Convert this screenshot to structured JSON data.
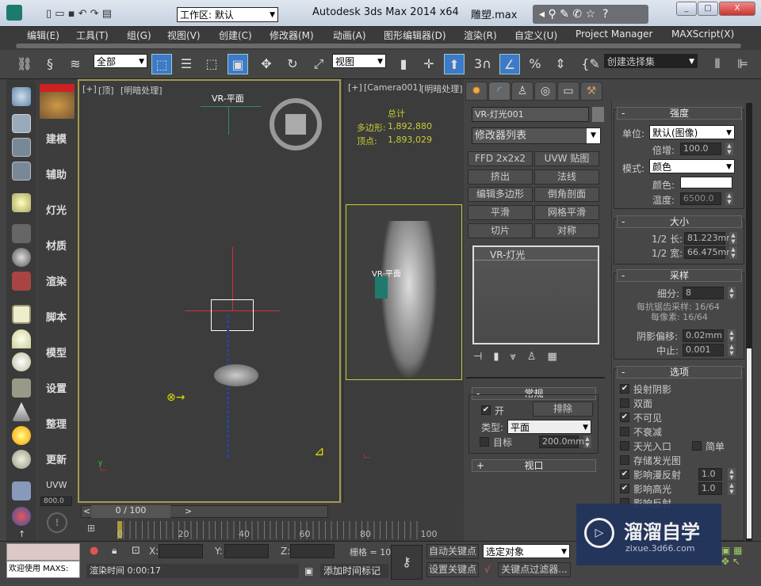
{
  "titlebar": {
    "workspace_label": "工作区: 默认",
    "app_title": "Autodesk 3ds Max  2014 x64",
    "file_name": "雕塑.max"
  },
  "menu": [
    "编辑(E)",
    "工具(T)",
    "组(G)",
    "视图(V)",
    "创建(C)",
    "修改器(M)",
    "动画(A)",
    "图形编辑器(D)",
    "渲染(R)",
    "自定义(U)",
    "Project Manager",
    "MAXScript(X)"
  ],
  "toolbar": {
    "filter_value": "全部",
    "ref_coord_value": "视图",
    "snap_value": "3",
    "selection_set_value": "创建选择集"
  },
  "left_labels": [
    "建模",
    "辅助",
    "灯光",
    "材质",
    "渲染",
    "脚本",
    "模型",
    "设置",
    "整理",
    "更新",
    "UVW"
  ],
  "left_spinner_value": "800.0",
  "viewport_top": {
    "label_plus": "[+]",
    "label_view": "[顶]",
    "label_shading": "[明暗处理]",
    "object_label": "VR-平面"
  },
  "viewport_camera": {
    "label_plus": "[+]",
    "label_view": "[Camera001]",
    "label_shading": "[明暗处理]",
    "stats_title": "总计",
    "poly_label": "多边形:",
    "poly_value": "1,892,880",
    "vert_label": "顶点:",
    "vert_value": "1,893,029",
    "object_label": "VR-平面"
  },
  "command_panel": {
    "object_name": "VR-灯光001",
    "modifier_list": "修改器列表",
    "modifier_buttons": [
      "FFD 2x2x2",
      "UVW 贴图",
      "挤出",
      "法线",
      "编辑多边形",
      "倒角剖面",
      "平滑",
      "网格平滑",
      "切片",
      "对称"
    ],
    "stack_item": "VR-灯光",
    "general": {
      "title": "常规",
      "on_label": "开",
      "on_checked": true,
      "exclude_label": "排除",
      "type_label": "类型:",
      "type_value": "平面",
      "target_label": "目标",
      "target_checked": false,
      "target_value": "200.0mm"
    },
    "viewport_rollout": "视口",
    "intensity": {
      "title": "强度",
      "unit_label": "单位:",
      "unit_value": "默认(图像)",
      "mult_label": "倍增:",
      "mult_value": "100.0",
      "mode_label": "模式:",
      "mode_value": "颜色",
      "color_label": "颜色:",
      "color_value": "#ffffff",
      "temp_label": "温度:",
      "temp_value": "6500.0"
    },
    "size": {
      "title": "大小",
      "half_len_label": "1/2 长:",
      "half_len_value": "81.223mm",
      "half_wid_label": "1/2 宽:",
      "half_wid_value": "66.475mm"
    },
    "sampling": {
      "title": "采样",
      "subdiv_label": "细分:",
      "subdiv_value": "8",
      "aa_text": "每抗锯齿采样: 16/64",
      "px_text": "每像素: 16/64",
      "bias_label": "阴影偏移:",
      "bias_value": "0.02mm",
      "cutoff_label": "中止:",
      "cutoff_value": "0.001"
    },
    "options": {
      "title": "选项",
      "items": [
        {
          "label": "投射阴影",
          "checked": true
        },
        {
          "label": "双面",
          "checked": false
        },
        {
          "label": "不可见",
          "checked": true
        },
        {
          "label": "不衰减",
          "checked": false
        },
        {
          "label": "天光入口",
          "checked": false
        },
        {
          "label": "存储发光图",
          "checked": false
        },
        {
          "label": "影响漫反射",
          "checked": true,
          "value": "1.0"
        },
        {
          "label": "影响高光",
          "checked": true,
          "value": "1.0"
        },
        {
          "label": "影响反射",
          "checked": false
        }
      ],
      "simple_label": "简单",
      "simple_checked": false
    }
  },
  "timeline": {
    "frame_display": "0 / 100",
    "ticks": [
      "0",
      "20",
      "40",
      "60",
      "80",
      "100"
    ],
    "position": 0
  },
  "status": {
    "welcome": "欢迎使用 MAXS:",
    "render_time": "渲染时间 0:00:17",
    "x_label": "X:",
    "y_label": "Y:",
    "z_label": "Z:",
    "grid": "栅格 = 10",
    "add_time_tag": "添加时间标记",
    "auto_key": "自动关键点",
    "set_key": "设置关键点",
    "selected_object": "选定对象",
    "key_filters": "关键点过滤器..."
  },
  "watermark": {
    "brand": "溜溜自学",
    "url": "zixue.3d66.com"
  }
}
